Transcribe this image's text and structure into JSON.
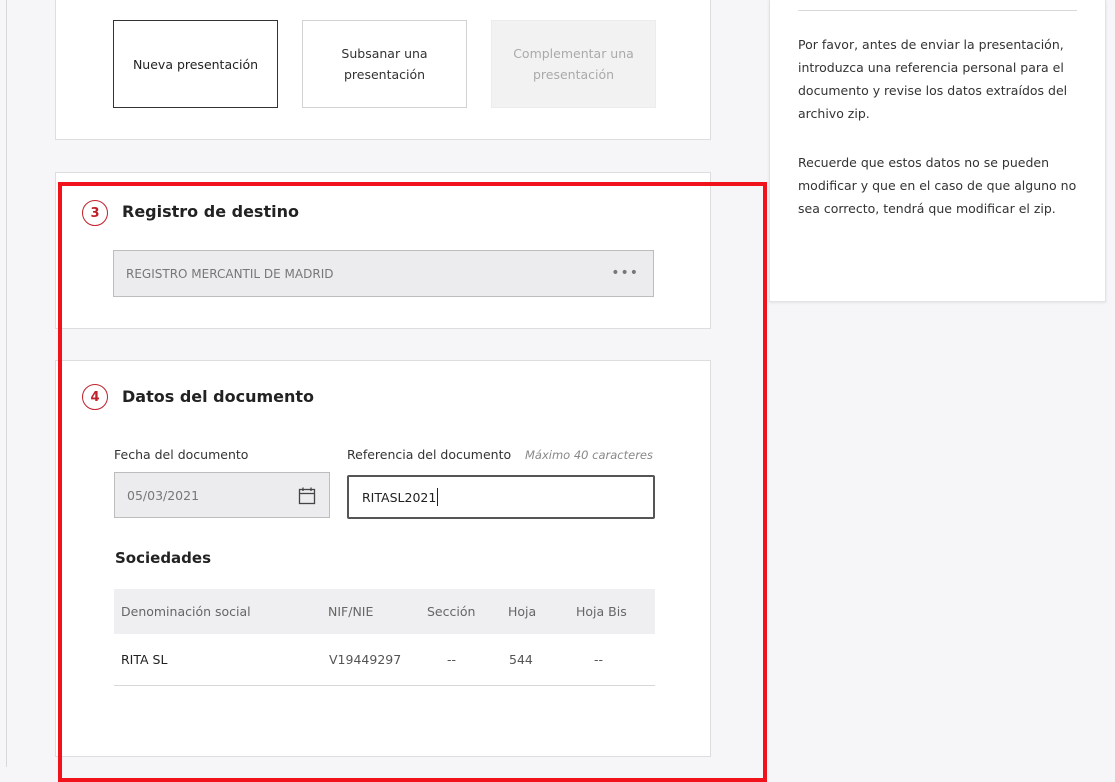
{
  "presentation_type": {
    "new_label": "Nueva presentación",
    "amend_label": "Subsanar una presentación",
    "complement_label": "Complementar una presentación"
  },
  "registro": {
    "step": "3",
    "title": "Registro de destino",
    "value": "REGISTRO MERCANTIL DE MADRID",
    "more_symbol": "•••"
  },
  "documento": {
    "step": "4",
    "title": "Datos del documento",
    "date_label": "Fecha del documento",
    "date_value": "05/03/2021",
    "ref_label": "Referencia del documento",
    "ref_hint": "Máximo 40 caracteres",
    "ref_value": "RITASL2021"
  },
  "sociedades": {
    "title": "Sociedades",
    "columns": [
      "Denominación social",
      "NIF/NIE",
      "Sección",
      "Hoja",
      "Hoja Bis"
    ],
    "rows": [
      [
        "RITA SL",
        "V19449297",
        "--",
        "544",
        "--"
      ]
    ]
  },
  "help": {
    "paragraph1": "Por favor, antes de enviar la presentación, introduzca una referencia personal para el documento y revise los datos extraídos del archivo zip.",
    "paragraph2": "Recuerde que estos datos no se pueden modificar y que en el caso de que alguno no sea correcto, tendrá que modificar el zip."
  },
  "colors": {
    "accent": "#c0202a",
    "highlight": "#f0131c"
  }
}
